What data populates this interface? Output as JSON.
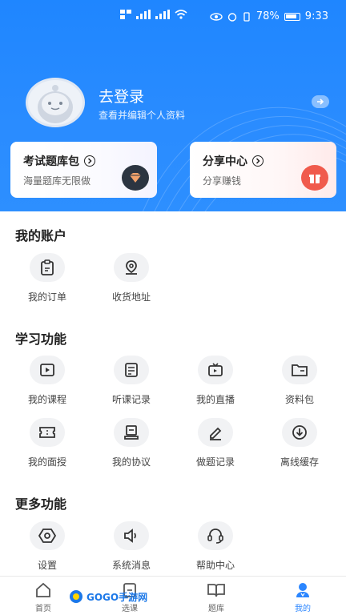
{
  "status_bar": {
    "battery_percent": "78%",
    "time": "9:33"
  },
  "profile": {
    "login_label": "去登录",
    "login_sub": "查看并编辑个人资料"
  },
  "cards": {
    "exam_pack": {
      "title": "考试题库包",
      "subtitle": "海量题库无限做"
    },
    "share_center": {
      "title": "分享中心",
      "subtitle": "分享赚钱"
    }
  },
  "sections": {
    "account": {
      "title": "我的账户",
      "items": [
        {
          "label": "我的订单",
          "icon": "clipboard-icon"
        },
        {
          "label": "收货地址",
          "icon": "location-pin-icon"
        }
      ]
    },
    "study": {
      "title": "学习功能",
      "items": [
        {
          "label": "我的课程",
          "icon": "play-video-icon"
        },
        {
          "label": "听课记录",
          "icon": "document-icon"
        },
        {
          "label": "我的直播",
          "icon": "tv-live-icon"
        },
        {
          "label": "资料包",
          "icon": "folder-icon"
        },
        {
          "label": "我的面授",
          "icon": "ticket-icon"
        },
        {
          "label": "我的协议",
          "icon": "contract-icon"
        },
        {
          "label": "做题记录",
          "icon": "pen-icon"
        },
        {
          "label": "离线缓存",
          "icon": "download-icon"
        }
      ]
    },
    "more": {
      "title": "更多功能",
      "items": [
        {
          "label": "设置",
          "icon": "settings-icon"
        },
        {
          "label": "系统消息",
          "icon": "speaker-icon"
        },
        {
          "label": "帮助中心",
          "icon": "headset-icon"
        }
      ]
    }
  },
  "tabbar": {
    "items": [
      {
        "label": "首页",
        "icon": "home-icon"
      },
      {
        "label": "选课",
        "icon": "course-icon"
      },
      {
        "label": "题库",
        "icon": "book-icon"
      },
      {
        "label": "我的",
        "icon": "user-icon"
      }
    ],
    "active_index": 3
  },
  "watermark": {
    "text": "GOGO手游网"
  },
  "colors": {
    "primary": "#2b86ff",
    "header_blue": "#2a8cff",
    "badge_dark": "#2c3541",
    "badge_red": "#f05a4c"
  }
}
